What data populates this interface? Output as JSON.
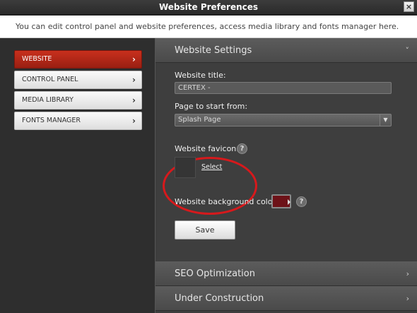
{
  "window": {
    "title": "Website Preferences",
    "close_label": "×"
  },
  "info": {
    "text": "You can edit control panel and website preferences, access media library and fonts manager here."
  },
  "sidebar": {
    "items": [
      {
        "label": "WEBSITE",
        "chev": "›"
      },
      {
        "label": "CONTROL PANEL",
        "chev": "›"
      },
      {
        "label": "MEDIA LIBRARY",
        "chev": "›"
      },
      {
        "label": "FONTS MANAGER",
        "chev": "›"
      }
    ],
    "active_index": 0
  },
  "sections": {
    "website_settings": {
      "title": "Website Settings",
      "chev": "˅"
    },
    "seo": {
      "title": "SEO Optimization",
      "chev": "›"
    },
    "under_construction": {
      "title": "Under Construction",
      "chev": "›"
    }
  },
  "form": {
    "website_title_label": "Website title:",
    "website_title_value": "CERTEX -",
    "start_page_label": "Page to start from:",
    "start_page_value": "Splash Page",
    "favicon_label": "Website favicon:",
    "favicon_select": "Select",
    "bg_color_label": "Website background color:",
    "bg_color_value": "#6d1218",
    "help_glyph": "?",
    "save_label": "Save"
  },
  "colors": {
    "accent": "#c8301d",
    "highlight_ring": "#d7191c"
  }
}
